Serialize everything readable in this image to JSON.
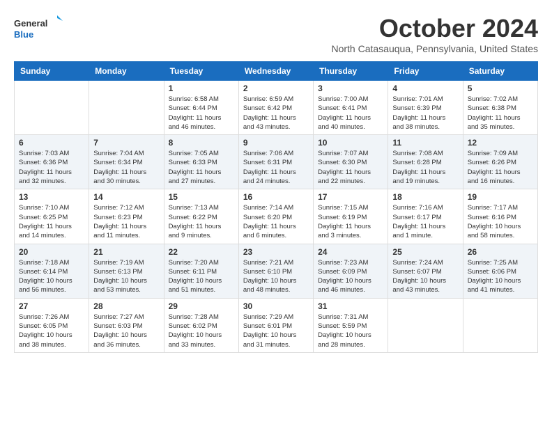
{
  "logo": {
    "line1": "General",
    "line2": "Blue"
  },
  "title": "October 2024",
  "location": "North Catasauqua, Pennsylvania, United States",
  "weekdays": [
    "Sunday",
    "Monday",
    "Tuesday",
    "Wednesday",
    "Thursday",
    "Friday",
    "Saturday"
  ],
  "weeks": [
    [
      {
        "day": "",
        "info": ""
      },
      {
        "day": "",
        "info": ""
      },
      {
        "day": "1",
        "info": "Sunrise: 6:58 AM\nSunset: 6:44 PM\nDaylight: 11 hours and 46 minutes."
      },
      {
        "day": "2",
        "info": "Sunrise: 6:59 AM\nSunset: 6:42 PM\nDaylight: 11 hours and 43 minutes."
      },
      {
        "day": "3",
        "info": "Sunrise: 7:00 AM\nSunset: 6:41 PM\nDaylight: 11 hours and 40 minutes."
      },
      {
        "day": "4",
        "info": "Sunrise: 7:01 AM\nSunset: 6:39 PM\nDaylight: 11 hours and 38 minutes."
      },
      {
        "day": "5",
        "info": "Sunrise: 7:02 AM\nSunset: 6:38 PM\nDaylight: 11 hours and 35 minutes."
      }
    ],
    [
      {
        "day": "6",
        "info": "Sunrise: 7:03 AM\nSunset: 6:36 PM\nDaylight: 11 hours and 32 minutes."
      },
      {
        "day": "7",
        "info": "Sunrise: 7:04 AM\nSunset: 6:34 PM\nDaylight: 11 hours and 30 minutes."
      },
      {
        "day": "8",
        "info": "Sunrise: 7:05 AM\nSunset: 6:33 PM\nDaylight: 11 hours and 27 minutes."
      },
      {
        "day": "9",
        "info": "Sunrise: 7:06 AM\nSunset: 6:31 PM\nDaylight: 11 hours and 24 minutes."
      },
      {
        "day": "10",
        "info": "Sunrise: 7:07 AM\nSunset: 6:30 PM\nDaylight: 11 hours and 22 minutes."
      },
      {
        "day": "11",
        "info": "Sunrise: 7:08 AM\nSunset: 6:28 PM\nDaylight: 11 hours and 19 minutes."
      },
      {
        "day": "12",
        "info": "Sunrise: 7:09 AM\nSunset: 6:26 PM\nDaylight: 11 hours and 16 minutes."
      }
    ],
    [
      {
        "day": "13",
        "info": "Sunrise: 7:10 AM\nSunset: 6:25 PM\nDaylight: 11 hours and 14 minutes."
      },
      {
        "day": "14",
        "info": "Sunrise: 7:12 AM\nSunset: 6:23 PM\nDaylight: 11 hours and 11 minutes."
      },
      {
        "day": "15",
        "info": "Sunrise: 7:13 AM\nSunset: 6:22 PM\nDaylight: 11 hours and 9 minutes."
      },
      {
        "day": "16",
        "info": "Sunrise: 7:14 AM\nSunset: 6:20 PM\nDaylight: 11 hours and 6 minutes."
      },
      {
        "day": "17",
        "info": "Sunrise: 7:15 AM\nSunset: 6:19 PM\nDaylight: 11 hours and 3 minutes."
      },
      {
        "day": "18",
        "info": "Sunrise: 7:16 AM\nSunset: 6:17 PM\nDaylight: 11 hours and 1 minute."
      },
      {
        "day": "19",
        "info": "Sunrise: 7:17 AM\nSunset: 6:16 PM\nDaylight: 10 hours and 58 minutes."
      }
    ],
    [
      {
        "day": "20",
        "info": "Sunrise: 7:18 AM\nSunset: 6:14 PM\nDaylight: 10 hours and 56 minutes."
      },
      {
        "day": "21",
        "info": "Sunrise: 7:19 AM\nSunset: 6:13 PM\nDaylight: 10 hours and 53 minutes."
      },
      {
        "day": "22",
        "info": "Sunrise: 7:20 AM\nSunset: 6:11 PM\nDaylight: 10 hours and 51 minutes."
      },
      {
        "day": "23",
        "info": "Sunrise: 7:21 AM\nSunset: 6:10 PM\nDaylight: 10 hours and 48 minutes."
      },
      {
        "day": "24",
        "info": "Sunrise: 7:23 AM\nSunset: 6:09 PM\nDaylight: 10 hours and 46 minutes."
      },
      {
        "day": "25",
        "info": "Sunrise: 7:24 AM\nSunset: 6:07 PM\nDaylight: 10 hours and 43 minutes."
      },
      {
        "day": "26",
        "info": "Sunrise: 7:25 AM\nSunset: 6:06 PM\nDaylight: 10 hours and 41 minutes."
      }
    ],
    [
      {
        "day": "27",
        "info": "Sunrise: 7:26 AM\nSunset: 6:05 PM\nDaylight: 10 hours and 38 minutes."
      },
      {
        "day": "28",
        "info": "Sunrise: 7:27 AM\nSunset: 6:03 PM\nDaylight: 10 hours and 36 minutes."
      },
      {
        "day": "29",
        "info": "Sunrise: 7:28 AM\nSunset: 6:02 PM\nDaylight: 10 hours and 33 minutes."
      },
      {
        "day": "30",
        "info": "Sunrise: 7:29 AM\nSunset: 6:01 PM\nDaylight: 10 hours and 31 minutes."
      },
      {
        "day": "31",
        "info": "Sunrise: 7:31 AM\nSunset: 5:59 PM\nDaylight: 10 hours and 28 minutes."
      },
      {
        "day": "",
        "info": ""
      },
      {
        "day": "",
        "info": ""
      }
    ]
  ]
}
